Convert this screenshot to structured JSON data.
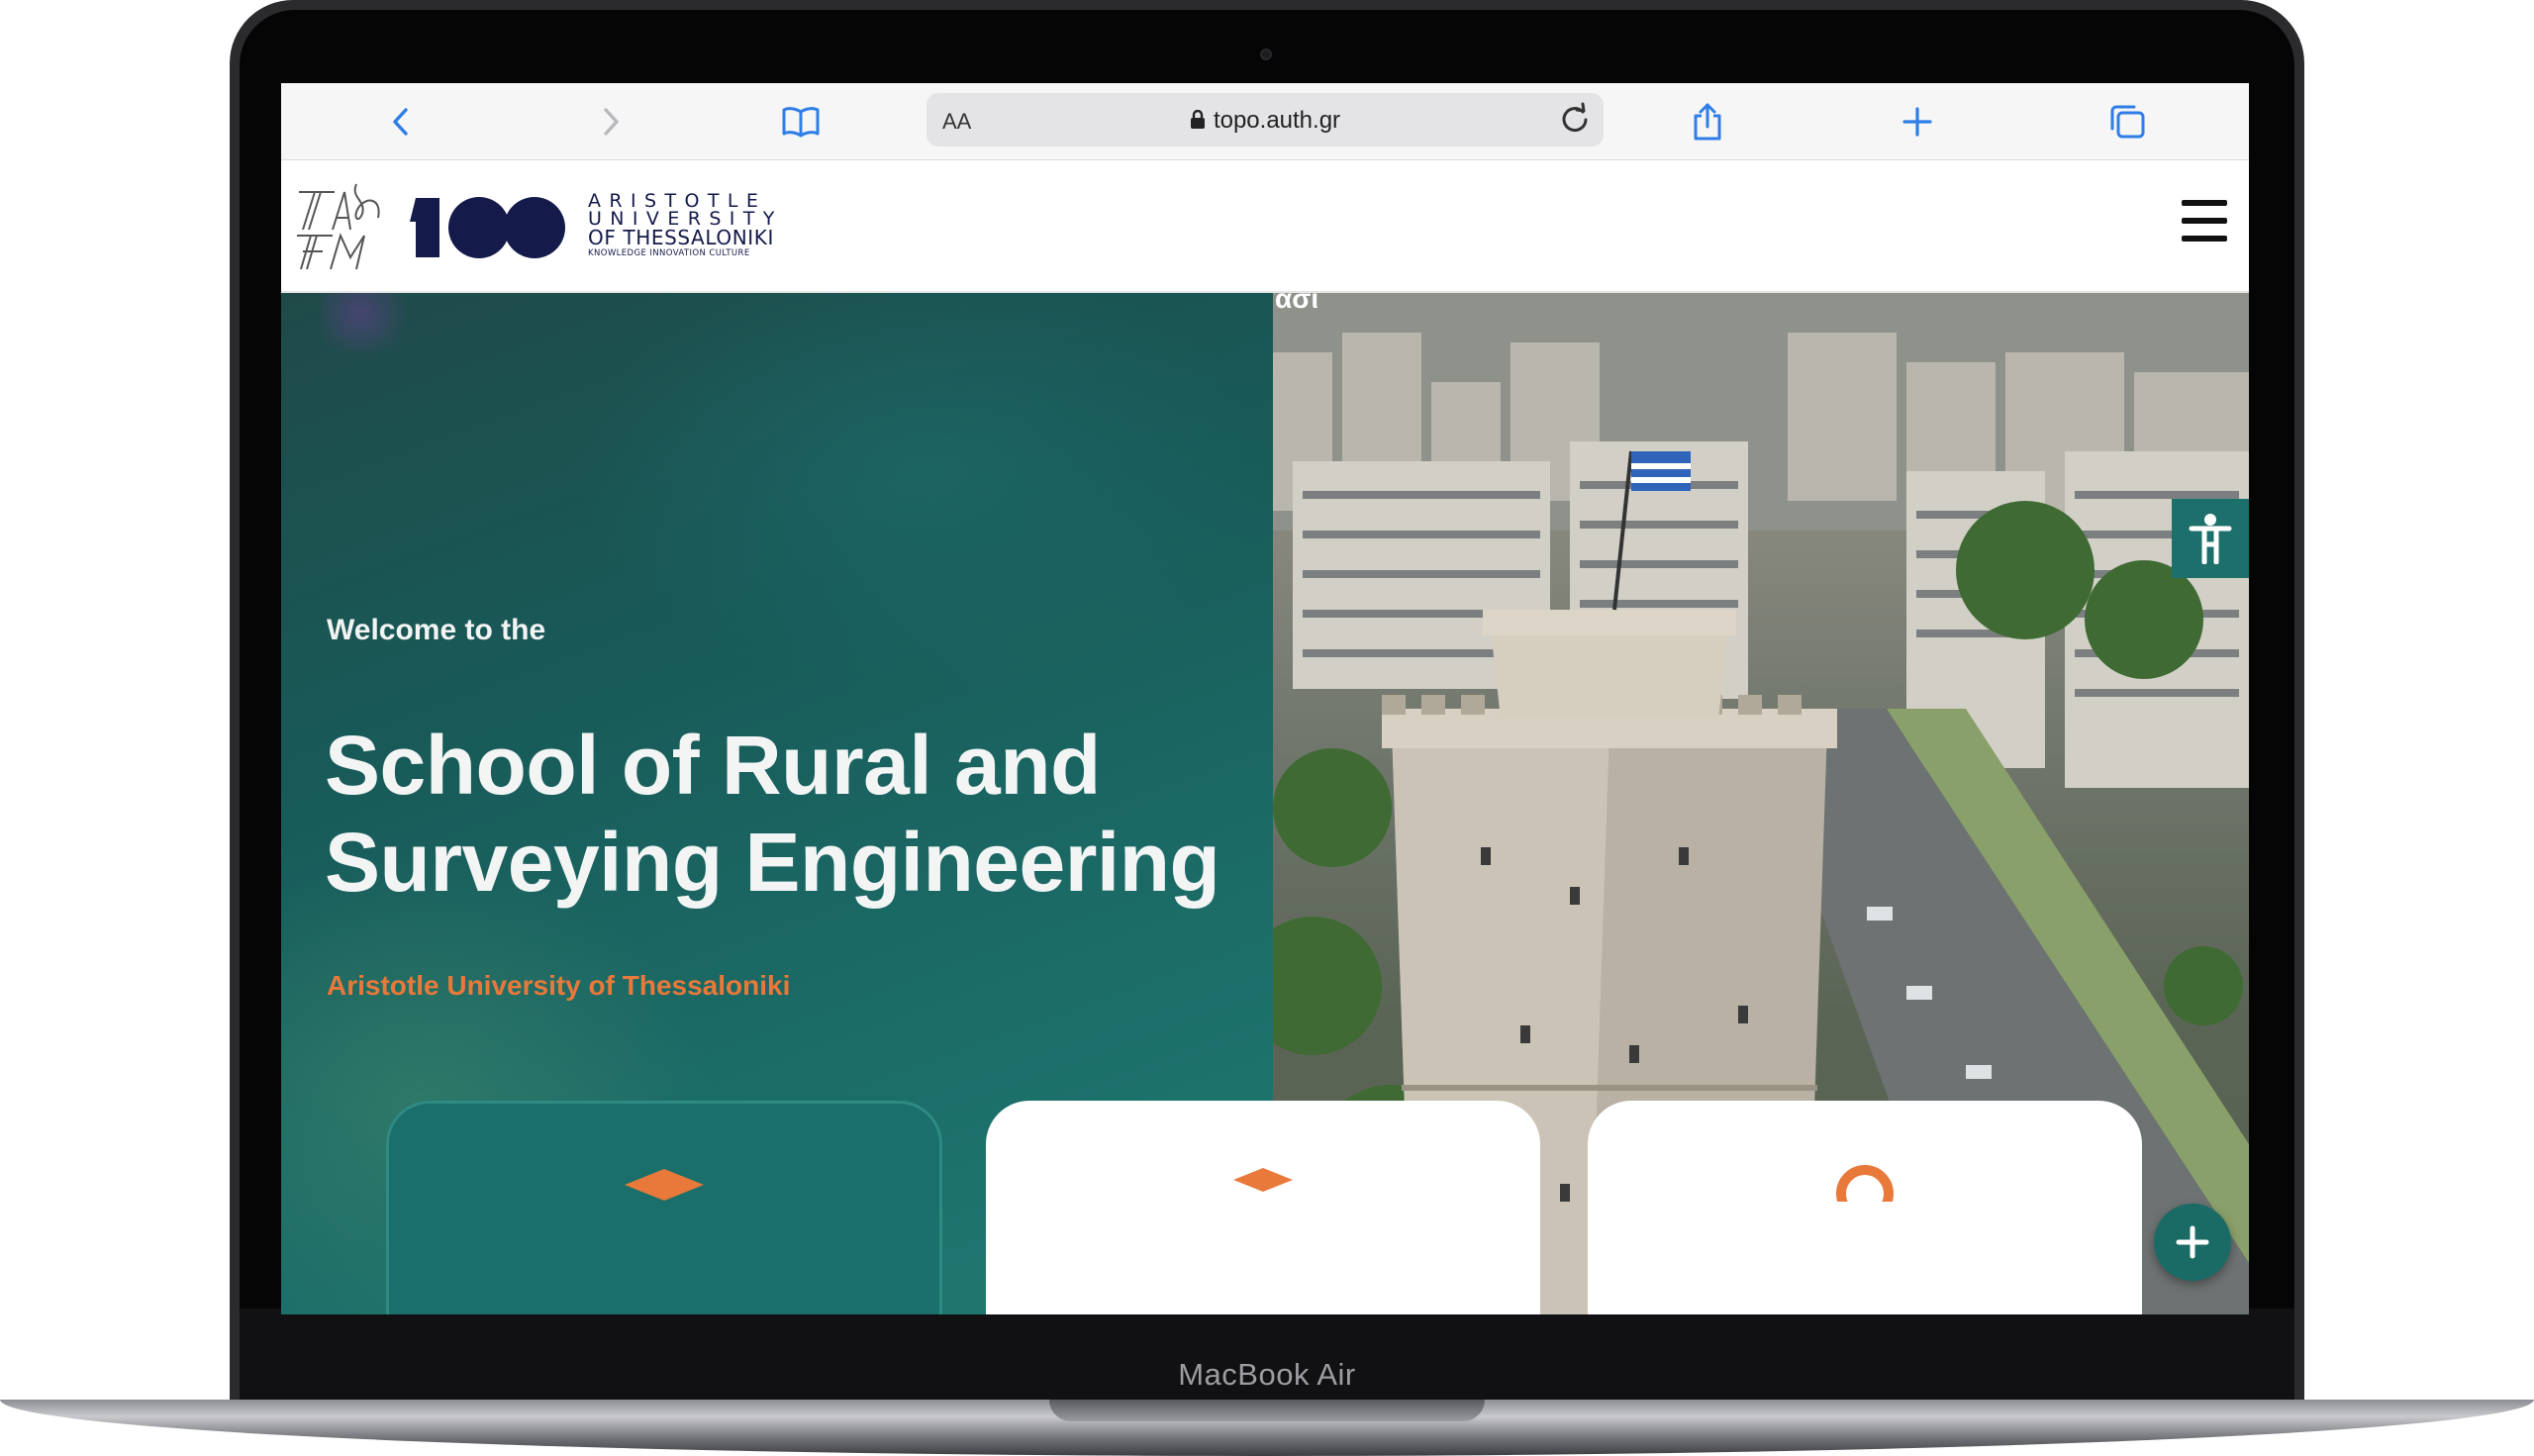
{
  "device": {
    "label": "MacBook Air"
  },
  "browser": {
    "text_size_label": "AA",
    "url": "topo.auth.gr",
    "icons": [
      "chevron-left-icon",
      "chevron-right-icon",
      "book-icon",
      "lock-icon",
      "reload-icon",
      "share-icon",
      "plus-icon",
      "tabs-icon"
    ]
  },
  "header": {
    "faculty_logo_alt": "TAΘ TM",
    "centenary_logo_alt": "100",
    "university_lines": [
      "ARISTOTLE",
      "UNIVERSITY",
      "OF THESSALONIKI",
      "KNOWLEDGE INNOVATION CULTURE"
    ],
    "menu_icon": "hamburger-menu-icon"
  },
  "hero": {
    "welcome": "Welcome to the",
    "title": "School of Rural and Surveying Engineering",
    "subtitle": "Aristotle University of Thessaloniki",
    "video_caption": "ασι",
    "colors": {
      "teal": "#1d6f6c",
      "accent": "#e8793a"
    }
  },
  "widgets": {
    "accessibility_icon": "accessibility-icon",
    "fab_icon": "plus-icon"
  },
  "cards": [
    {
      "icon": "graduation-icon",
      "color": "#e8793a"
    },
    {
      "icon": "graduation-icon",
      "color": "#e8793a"
    },
    {
      "icon": "location-icon",
      "color": "#e8793a"
    }
  ]
}
